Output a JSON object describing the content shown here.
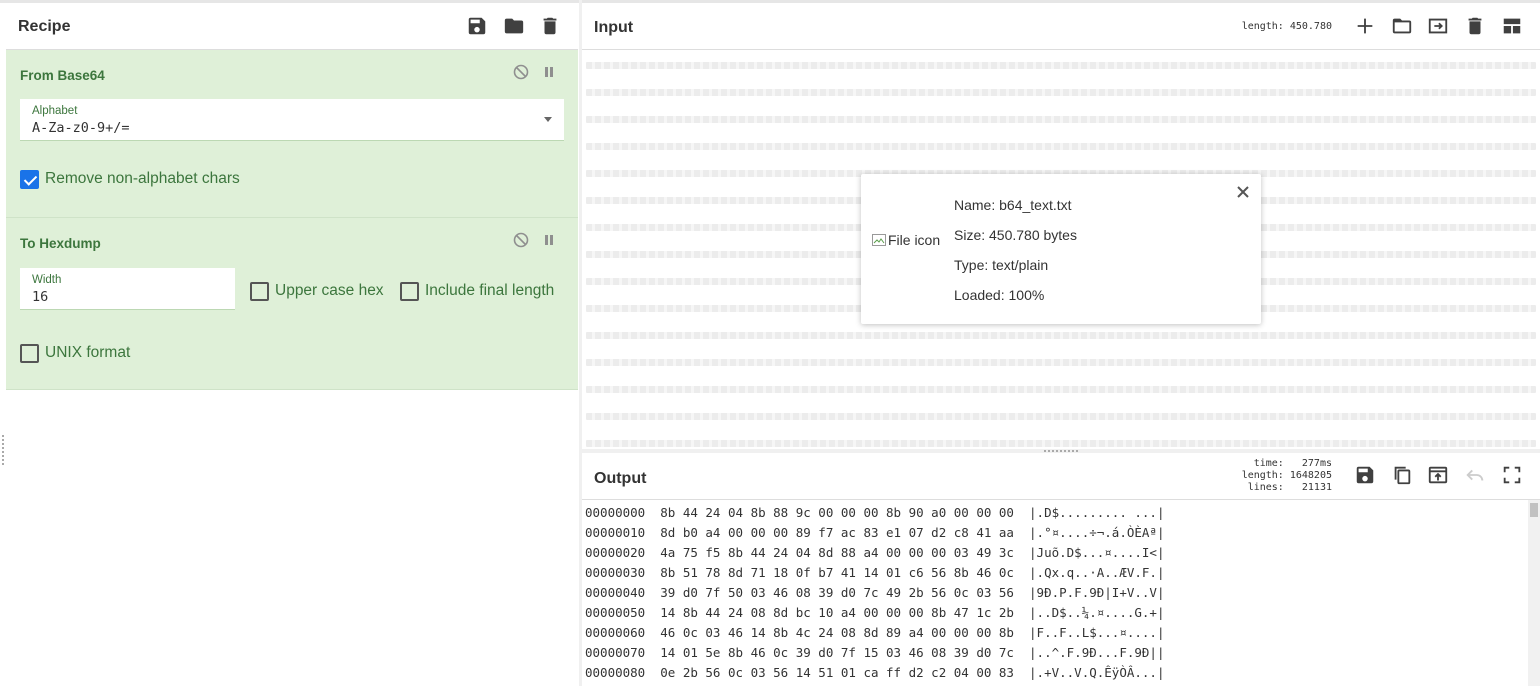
{
  "recipe": {
    "title": "Recipe",
    "operations": [
      {
        "title": "From Base64",
        "alphabet_label": "Alphabet",
        "alphabet_value": "A-Za-z0-9+/=",
        "remove_nonalpha_label": "Remove non-alphabet chars",
        "remove_nonalpha_checked": true
      },
      {
        "title": "To Hexdump",
        "width_label": "Width",
        "width_value": "16",
        "upper_case_label": "Upper case hex",
        "include_final_label": "Include final length",
        "unix_format_label": "UNIX format"
      }
    ]
  },
  "input": {
    "title": "Input",
    "info": "length: 450.780",
    "file": {
      "icon_alt": "File icon",
      "name": "Name: b64_text.txt",
      "size": "Size: 450.780 bytes",
      "type": "Type: text/plain",
      "loaded": "Loaded: 100%"
    }
  },
  "output": {
    "title": "Output",
    "info": "time:   277ms\nlength: 1648205\nlines:   21131",
    "lines": [
      "00000000  8b 44 24 04 8b 88 9c 00 00 00 8b 90 a0 00 00 00  |.D$......... ...|",
      "00000010  8d b0 a4 00 00 00 89 f7 ac 83 e1 07 d2 c8 41 aa  |.°¤....÷¬.á.ÒÈAª|",
      "00000020  4a 75 f5 8b 44 24 04 8d 88 a4 00 00 00 03 49 3c  |Juõ.D$...¤....I<|",
      "00000030  8b 51 78 8d 71 18 0f b7 41 14 01 c6 56 8b 46 0c  |.Qx.q..·A..ÆV.F.|",
      "00000040  39 d0 7f 50 03 46 08 39 d0 7c 49 2b 56 0c 03 56  |9Ð.P.F.9Ð|I+V..V|",
      "00000050  14 8b 44 24 08 8d bc 10 a4 00 00 00 8b 47 1c 2b  |..D$..¼.¤....G.+|",
      "00000060  46 0c 03 46 14 8b 4c 24 08 8d 89 a4 00 00 00 8b  |F..F..L$...¤....|",
      "00000070  14 01 5e 8b 46 0c 39 d0 7f 15 03 46 08 39 d0 7c  |..^.F.9Ð...F.9Ð||",
      "00000080  0e 2b 56 0c 03 56 14 51 01 ca ff d2 c2 04 00 83  |.+V..V.Q.ÊÿÒÂ...|"
    ]
  },
  "colors": {
    "op_bg": "#dff0d8",
    "op_text": "#3c763d",
    "checkbox_checked": "#1a73e8"
  },
  "icons": {
    "recipe_toolbar": [
      "save-icon",
      "folder-icon",
      "trash-icon"
    ],
    "op_controls": [
      "disable-icon",
      "pause-icon"
    ],
    "input_toolbar": [
      "plus-icon",
      "folder-icon",
      "input-arrow-icon",
      "trash-icon",
      "layout-icon"
    ],
    "output_toolbar": [
      "save-icon",
      "copy-icon",
      "open-in-input-icon",
      "undo-icon",
      "fullscreen-icon"
    ]
  }
}
